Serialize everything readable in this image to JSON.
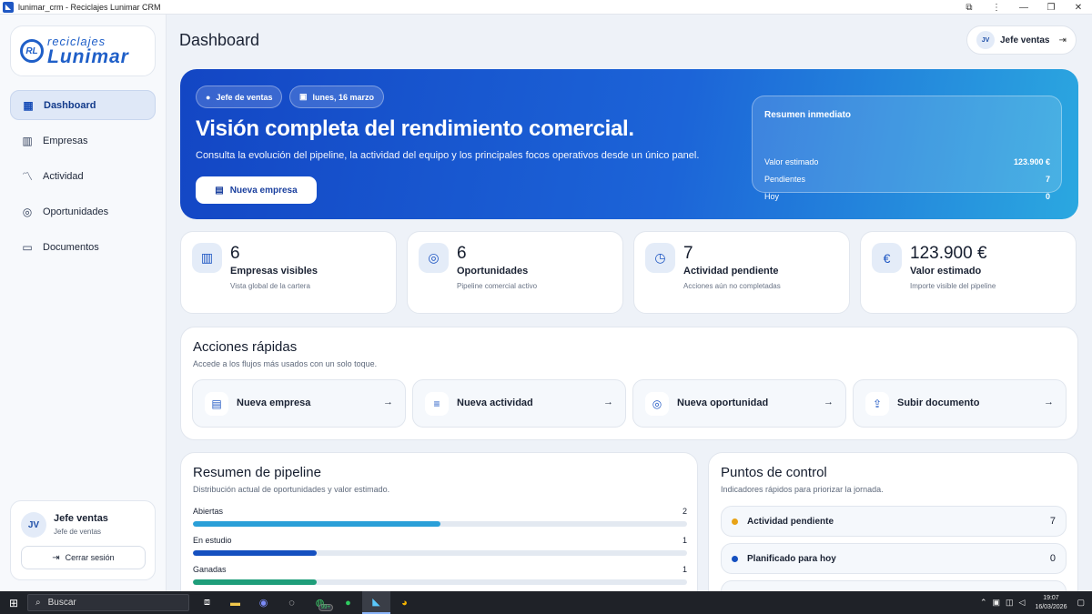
{
  "window": {
    "title": "lunimar_crm - Reciclajes Lunimar CRM",
    "controls": [
      "⧉",
      "⋮",
      "—",
      "❐",
      "✕"
    ]
  },
  "brand": {
    "mark": "RL",
    "line1": "reciclajes",
    "line2": "Lunimar",
    "color": "#1f5fc8"
  },
  "nav": {
    "items": [
      {
        "label": "Dashboard",
        "icon": "grid-icon",
        "active": true
      },
      {
        "label": "Empresas",
        "icon": "building-icon",
        "active": false
      },
      {
        "label": "Actividad",
        "icon": "activity-icon",
        "active": false
      },
      {
        "label": "Oportunidades",
        "icon": "target-icon",
        "active": false
      },
      {
        "label": "Documentos",
        "icon": "folder-icon",
        "active": false
      }
    ]
  },
  "user": {
    "initials": "JV",
    "name": "Jefe ventas",
    "role": "Jefe de ventas",
    "logout_label": "Cerrar sesión"
  },
  "header": {
    "title": "Dashboard",
    "user_initials": "JV",
    "user_name": "Jefe ventas"
  },
  "hero": {
    "chip_role": "Jefe de ventas",
    "chip_date": "lunes, 16 marzo",
    "title": "Visión completa del rendimiento comercial.",
    "subtitle": "Consulta la evolución del pipeline, la actividad del equipo y los principales focos operativos desde un único panel.",
    "button_label": "Nueva empresa",
    "summary": {
      "title": "Resumen inmediato",
      "rows": [
        {
          "label": "Valor estimado",
          "value": "123.900 €"
        },
        {
          "label": "Pendientes",
          "value": "7"
        },
        {
          "label": "Hoy",
          "value": "0"
        }
      ]
    },
    "gradient": [
      "#1346c4",
      "#2ba8e0"
    ]
  },
  "stats": [
    {
      "icon": "building-icon",
      "value": "6",
      "label": "Empresas visibles",
      "desc": "Vista global de la cartera"
    },
    {
      "icon": "target-icon",
      "value": "6",
      "label": "Oportunidades",
      "desc": "Pipeline comercial activo"
    },
    {
      "icon": "clock-icon",
      "value": "7",
      "label": "Actividad pendiente",
      "desc": "Acciones aún no completadas"
    },
    {
      "icon": "euro-icon",
      "value": "123.900 €",
      "label": "Valor estimado",
      "desc": "Importe visible del pipeline"
    }
  ],
  "quick_actions": {
    "title": "Acciones rápidas",
    "subtitle": "Accede a los flujos más usados con un solo toque.",
    "items": [
      {
        "label": "Nueva empresa",
        "icon": "add-building-icon"
      },
      {
        "label": "Nueva actividad",
        "icon": "edit-list-icon"
      },
      {
        "label": "Nueva oportunidad",
        "icon": "target-icon"
      },
      {
        "label": "Subir documento",
        "icon": "upload-file-icon"
      }
    ]
  },
  "pipeline": {
    "title": "Resumen de pipeline",
    "subtitle": "Distribución actual de oportunidades y valor estimado.",
    "rows": [
      {
        "label": "Abiertas",
        "count": "2",
        "fraction": 0.5,
        "color": "#2a9fd8"
      },
      {
        "label": "En estudio",
        "count": "1",
        "fraction": 0.25,
        "color": "#1550c0"
      },
      {
        "label": "Ganadas",
        "count": "1",
        "fraction": 0.25,
        "color": "#1f9e7a"
      }
    ]
  },
  "control": {
    "title": "Puntos de control",
    "subtitle": "Indicadores rápidos para priorizar la jornada.",
    "rows": [
      {
        "label": "Actividad pendiente",
        "value": "7",
        "color": "#e8a317"
      },
      {
        "label": "Planificado para hoy",
        "value": "0",
        "color": "#1550c0"
      }
    ]
  },
  "taskbar": {
    "search_placeholder": "Buscar",
    "badge": "99+",
    "time": "19:07",
    "date": "16/03/2026"
  }
}
